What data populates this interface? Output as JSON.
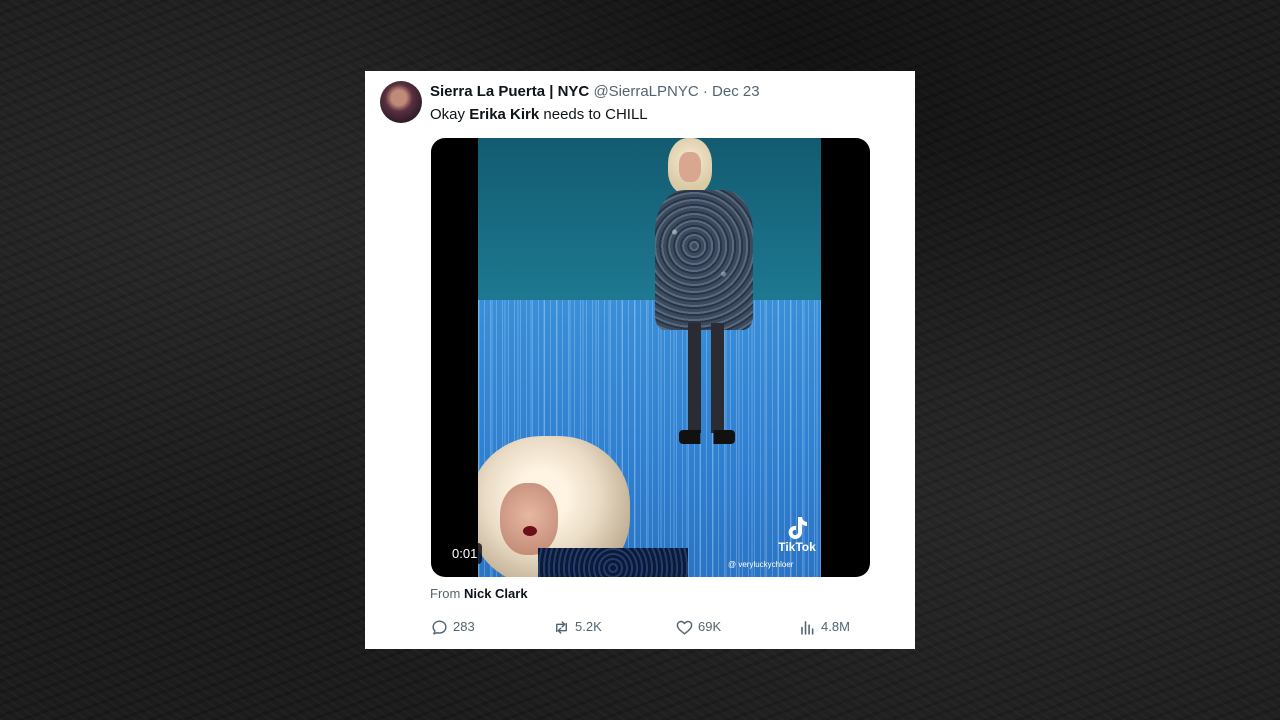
{
  "tweet": {
    "author_name": "Sierra La Puerta | NYC",
    "author_handle": "@SierraLPNYC",
    "separator": "·",
    "date": "Dec 23",
    "text_prefix": "Okay ",
    "text_bold": "Erika Kirk",
    "text_suffix": " needs to CHILL"
  },
  "media": {
    "timestamp": "0:01",
    "watermark_brand": "TikTok",
    "watermark_user": "@ veryluckychloer"
  },
  "attribution": {
    "prefix": "From",
    "source": "Nick Clark"
  },
  "actions": {
    "replies": "283",
    "reposts": "5.2K",
    "likes": "69K",
    "views": "4.8M"
  },
  "icons": [
    "avatar",
    "tiktok-icon",
    "reply-icon",
    "repost-icon",
    "like-icon",
    "views-icon"
  ]
}
